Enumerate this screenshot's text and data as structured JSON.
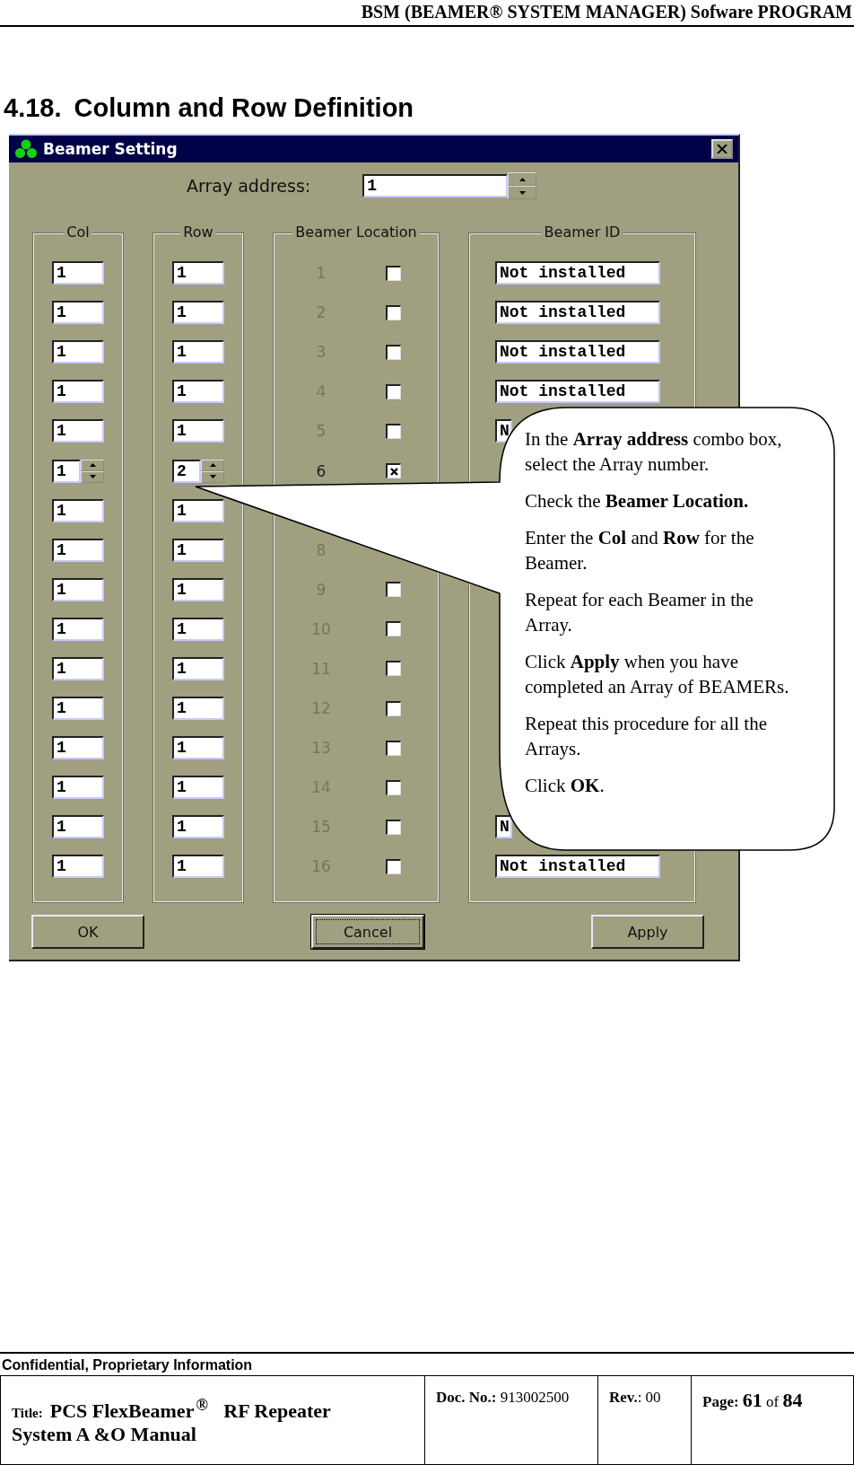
{
  "header": {
    "title": "BSM (BEAMER®  SYSTEM MANAGER) Sofware PROGRAM"
  },
  "section": {
    "number": "4.18.",
    "title": "Column and Row Definition"
  },
  "dialog": {
    "title": "Beamer Setting",
    "array_address": {
      "label": "Array address:",
      "value": "1"
    },
    "groups": {
      "col": "Col",
      "row": "Row",
      "location": "Beamer Location",
      "id": "Beamer ID"
    },
    "rows": [
      {
        "col": "1",
        "row": "1",
        "number": "1",
        "checked": false,
        "spin_buttons": false,
        "beamer_id": "Not installed"
      },
      {
        "col": "1",
        "row": "1",
        "number": "2",
        "checked": false,
        "spin_buttons": false,
        "beamer_id": "Not installed"
      },
      {
        "col": "1",
        "row": "1",
        "number": "3",
        "checked": false,
        "spin_buttons": false,
        "beamer_id": "Not installed"
      },
      {
        "col": "1",
        "row": "1",
        "number": "4",
        "checked": false,
        "spin_buttons": false,
        "beamer_id": "Not installed"
      },
      {
        "col": "1",
        "row": "1",
        "number": "5",
        "checked": false,
        "spin_buttons": false,
        "beamer_id": "N"
      },
      {
        "col": "1",
        "row": "2",
        "number": "6",
        "checked": true,
        "spin_buttons": true
      },
      {
        "col": "1",
        "row": "1",
        "spin_buttons": false
      },
      {
        "col": "1",
        "row": "1",
        "number": "8",
        "spin_buttons": false
      },
      {
        "col": "1",
        "row": "1",
        "number": "9",
        "checked": false,
        "spin_buttons": false
      },
      {
        "col": "1",
        "row": "1",
        "number": "10",
        "checked": false,
        "spin_buttons": false
      },
      {
        "col": "1",
        "row": "1",
        "number": "11",
        "checked": false,
        "spin_buttons": false
      },
      {
        "col": "1",
        "row": "1",
        "number": "12",
        "checked": false,
        "spin_buttons": false
      },
      {
        "col": "1",
        "row": "1",
        "number": "13",
        "checked": false,
        "spin_buttons": false
      },
      {
        "col": "1",
        "row": "1",
        "number": "14",
        "checked": false,
        "spin_buttons": false
      },
      {
        "col": "1",
        "row": "1",
        "number": "15",
        "checked": false,
        "spin_buttons": false,
        "beamer_id": "N"
      },
      {
        "col": "1",
        "row": "1",
        "number": "16",
        "checked": false,
        "spin_buttons": false,
        "beamer_id": "Not installed"
      }
    ],
    "buttons": [
      {
        "label": "OK",
        "focused": false
      },
      {
        "label": "Cancel",
        "focused": true
      },
      {
        "label": "Apply",
        "focused": false
      }
    ]
  },
  "callout": {
    "paragraphs": [
      "In the **Array address** combo box, select the Array number.",
      "Check the **Beamer Location.**",
      "Enter the **Col** and **Row** for the Beamer.",
      "Repeat for each Beamer in the Array.",
      "Click **Apply** when you have completed an Array of BEAMERs.",
      "Repeat this procedure for all the Arrays.",
      "Click **OK**."
    ]
  },
  "footer": {
    "notice": "Confidential, Proprietary Information",
    "title_label": "Title:",
    "title_lines": [
      "PCS FlexBeamer$^{®}$ RF Repeater",
      "System A &O Manual"
    ],
    "doc_no": "**Doc. No.:** 913002500",
    "rev": "**Rev.**: 00",
    "page": "**Page:** **61** of **84**"
  }
}
